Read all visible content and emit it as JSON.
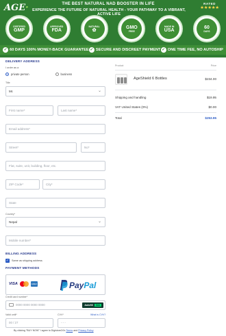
{
  "header": {
    "logo": "AGE",
    "logo_dot": "·",
    "tagline1": "THE BEST NATURAL NAD BOOSTER IN LIFE",
    "tagline2": "EXPERIENCE THE FUTURE OF NATURAL HEALTH - YOUR PATHWAY TO A VIBRANT, ACTIVE LIFE",
    "rated_label": "RATED",
    "rated_stars": "★★★★★",
    "badges": [
      {
        "big": "GMP",
        "small": "CERTIFIED",
        "icon": "gmp-badge-icon"
      },
      {
        "big": "FDA",
        "small": "APPROVED",
        "icon": "fda-badge-icon"
      },
      {
        "big": "✿",
        "small": "NATURAL",
        "icon": "natural-badge-icon"
      },
      {
        "big": "GMO",
        "small": "FREE",
        "icon": "gmo-badge-icon"
      },
      {
        "big": "USA",
        "small": "MADE IN",
        "icon": "usa-badge-icon"
      },
      {
        "big": "60",
        "small": "DAYS",
        "icon": "sixty-days-badge-icon"
      }
    ],
    "guarantees": [
      "60 DAYS 100% MONEY-BACK GUARANTEE",
      "SECURE AND DISCREET PAYMENT",
      "ONE TIME FEE, NO AUTOSHIP"
    ]
  },
  "form": {
    "delivery_title": "DELIVERY ADDRESS",
    "i_am_a": "I order as a",
    "radio_private": "private person",
    "radio_business": "business",
    "title_label": "Title",
    "title_value": "Mr.",
    "first_name_placeholder": "First name*",
    "last_name_placeholder": "Last name*",
    "email_placeholder": "Email address*",
    "street_placeholder": "Street*",
    "no_placeholder": "No*",
    "flat_placeholder": "Flat, suite, unit, building, floor, etc.",
    "zip_placeholder": "ZIP Code*",
    "city_placeholder": "City*",
    "state_placeholder": "State",
    "country_label": "Country*",
    "country_value": "Nepal",
    "mobile_placeholder": "Mobile number*",
    "billing_title": "BILLING ADDRESS",
    "same_as_shipping": "Same as shipping address",
    "payment_title": "PAYMENT METHODS",
    "visa": "VISA",
    "amex": "AMEX",
    "paypal_1": "Pay",
    "paypal_2": "Pal",
    "card_number_label": "Credit card number*",
    "card_number_placeholder": "0000 0000 0000 0000",
    "autofill": "Autofill",
    "autofill_link": "link",
    "valid_until_label": "Valid until*",
    "cvv_label": "CVV*",
    "what_is_cvv": "What is CVV?",
    "valid_until_placeholder": "00 / 27",
    "cvv_placeholder": "- - -",
    "terms_pre": "By clicking \"BUY NOW\" I agree to Digistore24's",
    "terms_link1": "Terms",
    "terms_and": "and",
    "terms_link2": "Privacy Policy"
  },
  "summary": {
    "col_product": "Product",
    "col_price": "Price",
    "product_name": "AgeShield 6 Bottles",
    "product_price": "$234.00",
    "shipping_label": "Shipping and handling",
    "shipping_value": "$19.95",
    "vat_label": "VAT United States (0%)",
    "vat_value": "$0.00",
    "total_label": "Total",
    "total_value": "$253.95"
  }
}
